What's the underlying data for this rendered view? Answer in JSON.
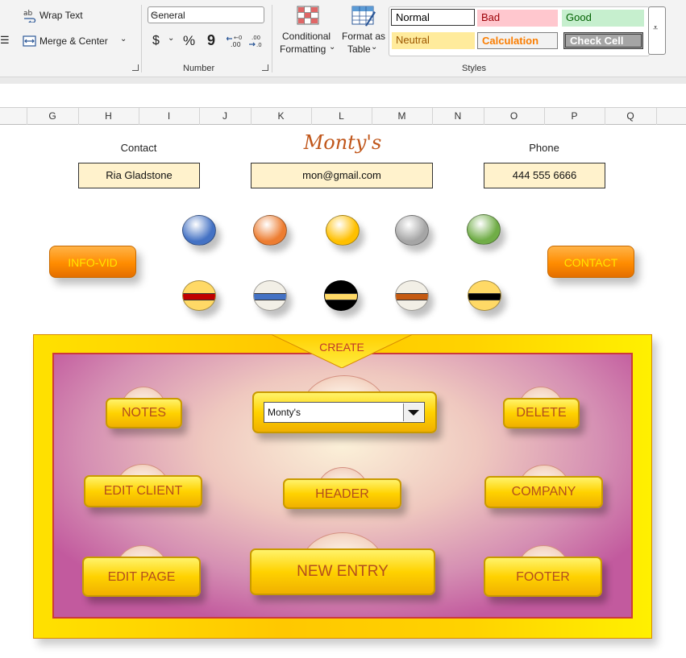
{
  "ribbon": {
    "wrap_text": "Wrap Text",
    "merge_center": "Merge & Center",
    "number_format": "General",
    "currency": "$",
    "percent": "%",
    "comma": "9",
    "number_group": "Number",
    "conditional_formatting": [
      "Conditional",
      "Formatting"
    ],
    "format_as_table": [
      "Format as",
      "Table"
    ],
    "styles_group": "Styles",
    "styles": {
      "normal": "Normal",
      "bad": "Bad",
      "good": "Good",
      "neutral": "Neutral",
      "calculation": "Calculation",
      "check_cell": "Check Cell"
    }
  },
  "columns": [
    "G",
    "H",
    "I",
    "J",
    "K",
    "L",
    "M",
    "N",
    "O",
    "P",
    "Q"
  ],
  "sheet": {
    "contact_label": "Contact",
    "contact_name": "Ria Gladstone",
    "title": "Monty's",
    "email": "mon@gmail.com",
    "phone_label": "Phone",
    "phone": "444 555 6666",
    "info_vid": "INFO-VID",
    "contact_btn": "CONTACT"
  },
  "swatches": {
    "solid": [
      "#4472c4",
      "#ed7d31",
      "#ffc000",
      "#a5a5a5",
      "#70ad47"
    ],
    "striped": [
      {
        "bg": "#ffd966",
        "stripe": "#c00000"
      },
      {
        "bg": "#f2efe6",
        "stripe": "#4472c4"
      },
      {
        "bg": "#000000",
        "stripe": "#ffd966"
      },
      {
        "bg": "#f2efe6",
        "stripe": "#c55a11"
      },
      {
        "bg": "#ffd966",
        "stripe": "#000000"
      }
    ]
  },
  "panel": {
    "create": "CREATE",
    "notes": "NOTES",
    "dropdown_value": "Monty's",
    "delete": "DELETE",
    "edit_client": "EDIT CLIENT",
    "header": "HEADER",
    "company": "COMPANY",
    "edit_page": "EDIT PAGE",
    "new_entry": "NEW ENTRY",
    "footer": "FOOTER"
  }
}
